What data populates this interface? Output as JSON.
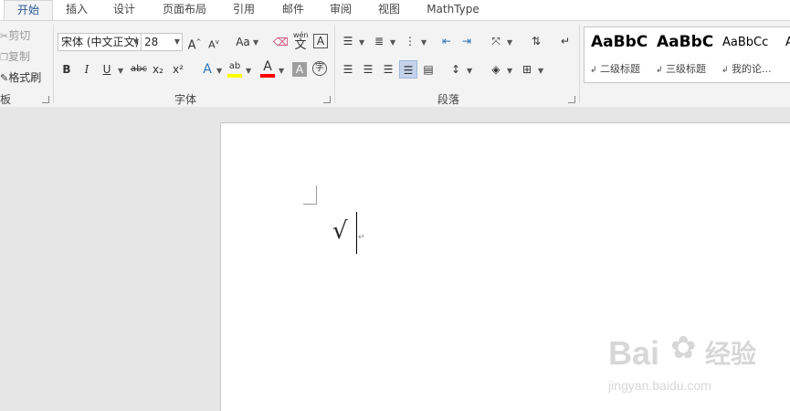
{
  "tabs": {
    "home": "开始",
    "insert": "插入",
    "design": "设计",
    "layout": "页面布局",
    "references": "引用",
    "mailings": "邮件",
    "review": "审阅",
    "view": "视图",
    "mathtype": "MathType"
  },
  "clipboard": {
    "cut": "剪切",
    "copy": "复制",
    "format_painter": "格式刷",
    "group_label": "板"
  },
  "font": {
    "name": "宋体 (中文正文)",
    "size": "28",
    "change_case": "Aa",
    "bold": "B",
    "italic": "I",
    "underline": "U",
    "strike": "abc",
    "subscript": "x₂",
    "superscript": "x²",
    "text_effects": "A",
    "highlight": "ab",
    "font_color": "A",
    "char_shading": "A",
    "enclose": "字",
    "phonetic": "wén",
    "phonetic_char": "文",
    "char_border": "A",
    "grow": "A",
    "shrink": "A",
    "group_label": "字体"
  },
  "paragraph": {
    "group_label": "段落"
  },
  "styles": {
    "items": [
      {
        "sample": "AaBbC",
        "name": "二级标题"
      },
      {
        "sample": "AaBbC",
        "name": "三级标题"
      },
      {
        "sample": "AaBbCc",
        "name": "我的论..."
      },
      {
        "sample": "A",
        "name": ""
      }
    ]
  },
  "document": {
    "content": "√",
    "para_mark": "↵"
  },
  "watermark": {
    "brand": "Bai",
    "brand_cn": "经验",
    "url": "jingyan.baidu.com"
  },
  "colors": {
    "accent": "#2b579a",
    "highlight_bar": "#ffff00",
    "font_color_bar": "#ff0000"
  }
}
